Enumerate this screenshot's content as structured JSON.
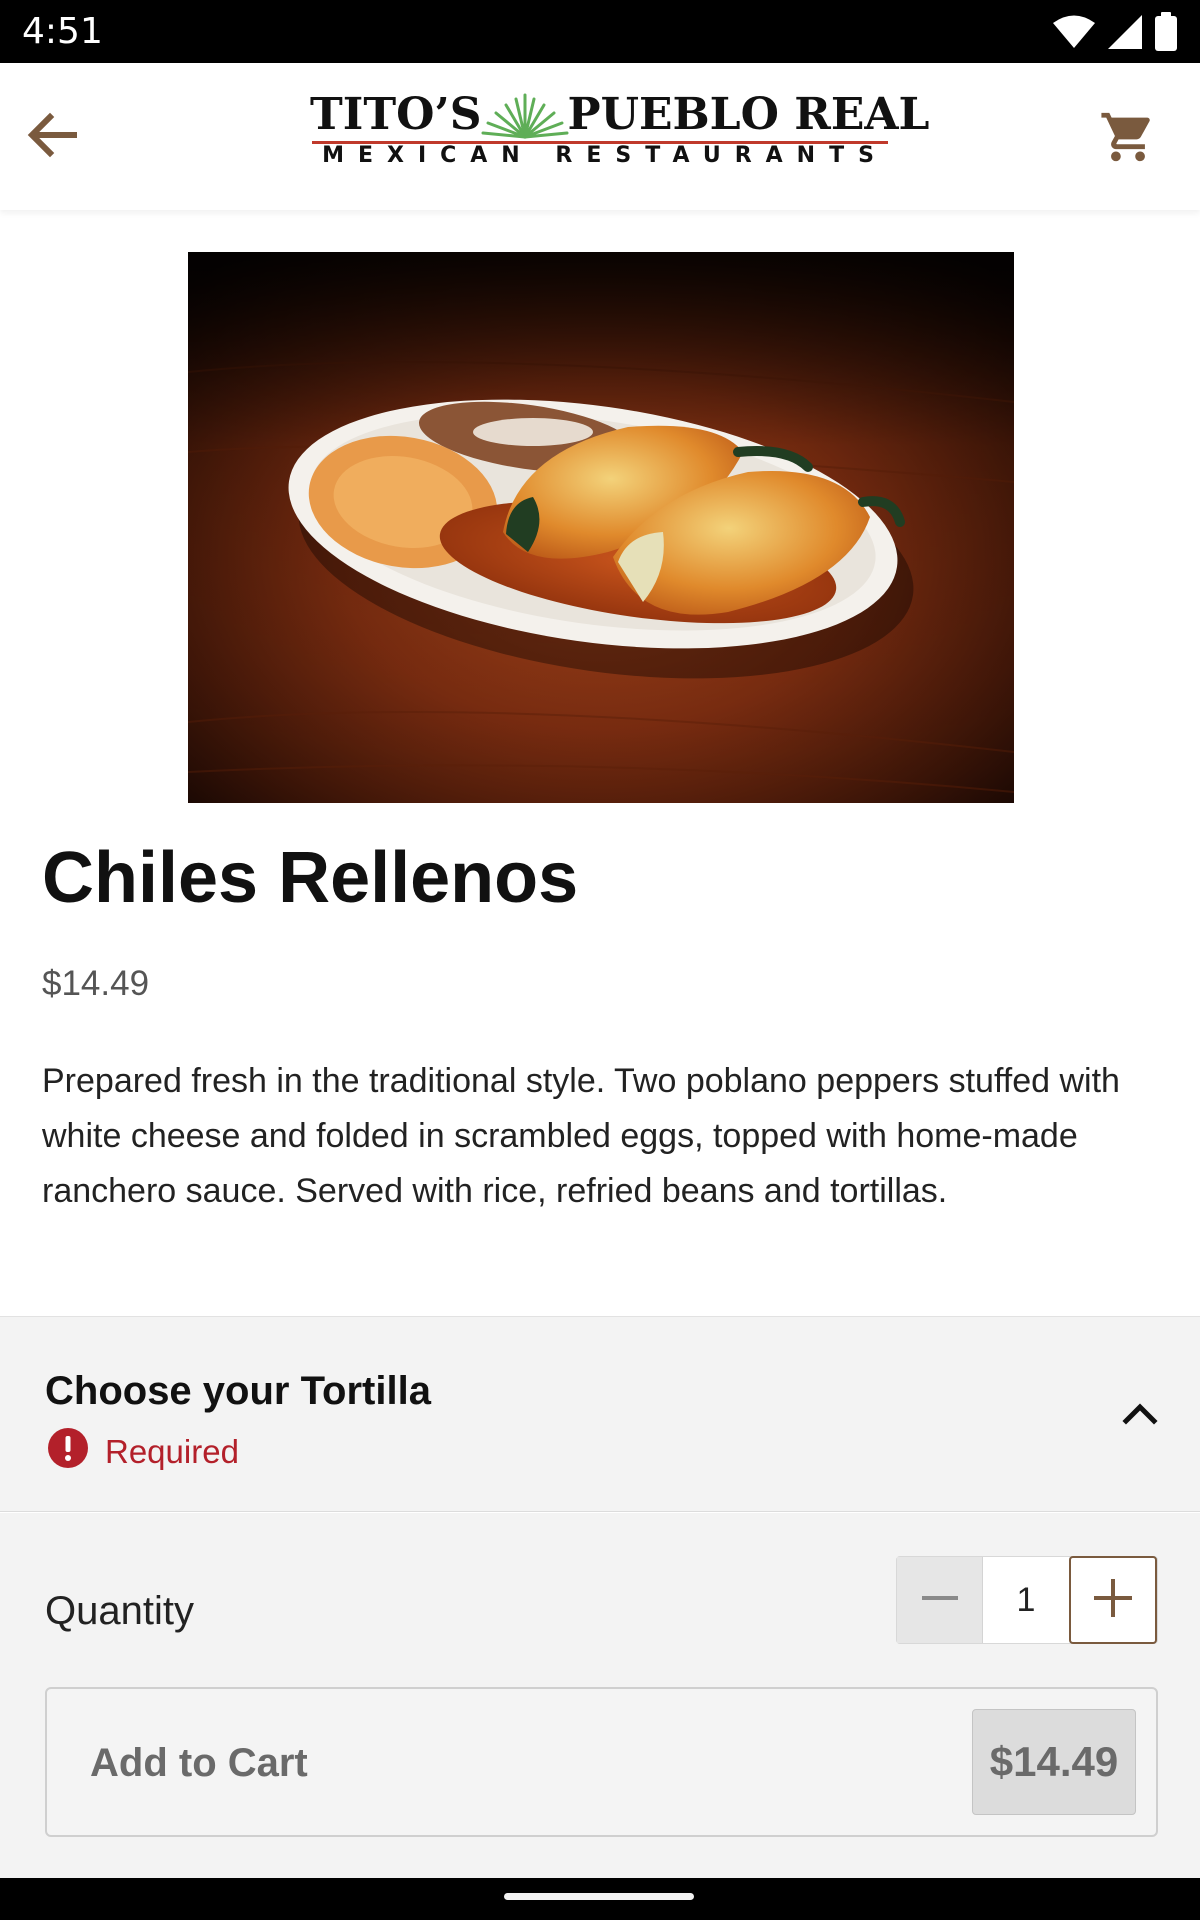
{
  "status_bar": {
    "time": "4:51",
    "icons": [
      "wifi-icon",
      "signal-icon",
      "battery-icon"
    ]
  },
  "header": {
    "back_icon": "arrow-left-icon",
    "logo_main_left": "TITO’S",
    "logo_main_right": "PUEBLO REAL",
    "logo_sub": "MEXICAN RESTAURANTS",
    "cart_icon": "shopping-cart-icon"
  },
  "item": {
    "title": "Chiles Rellenos",
    "price": "$14.49",
    "description": "Prepared fresh in the traditional style. Two poblano peppers stuffed with white cheese and folded in scrambled eggs, topped with home-made ranchero sauce. Served with rice, refried beans and tortillas."
  },
  "option_section": {
    "title": "Choose your Tortilla",
    "required_label": "Required",
    "required_icon": "alert-circle-icon",
    "toggle_icon": "chevron-up-icon"
  },
  "quantity": {
    "label": "Quantity",
    "value": "1",
    "minus_icon": "minus-icon",
    "plus_icon": "plus-icon"
  },
  "cart_button": {
    "label": "Add to Cart",
    "price": "$14.49"
  },
  "colors": {
    "accent_brown": "#7a5a3e",
    "required_red": "#b3202a",
    "logo_red": "#c0392b",
    "agave_green": "#5fae57"
  }
}
